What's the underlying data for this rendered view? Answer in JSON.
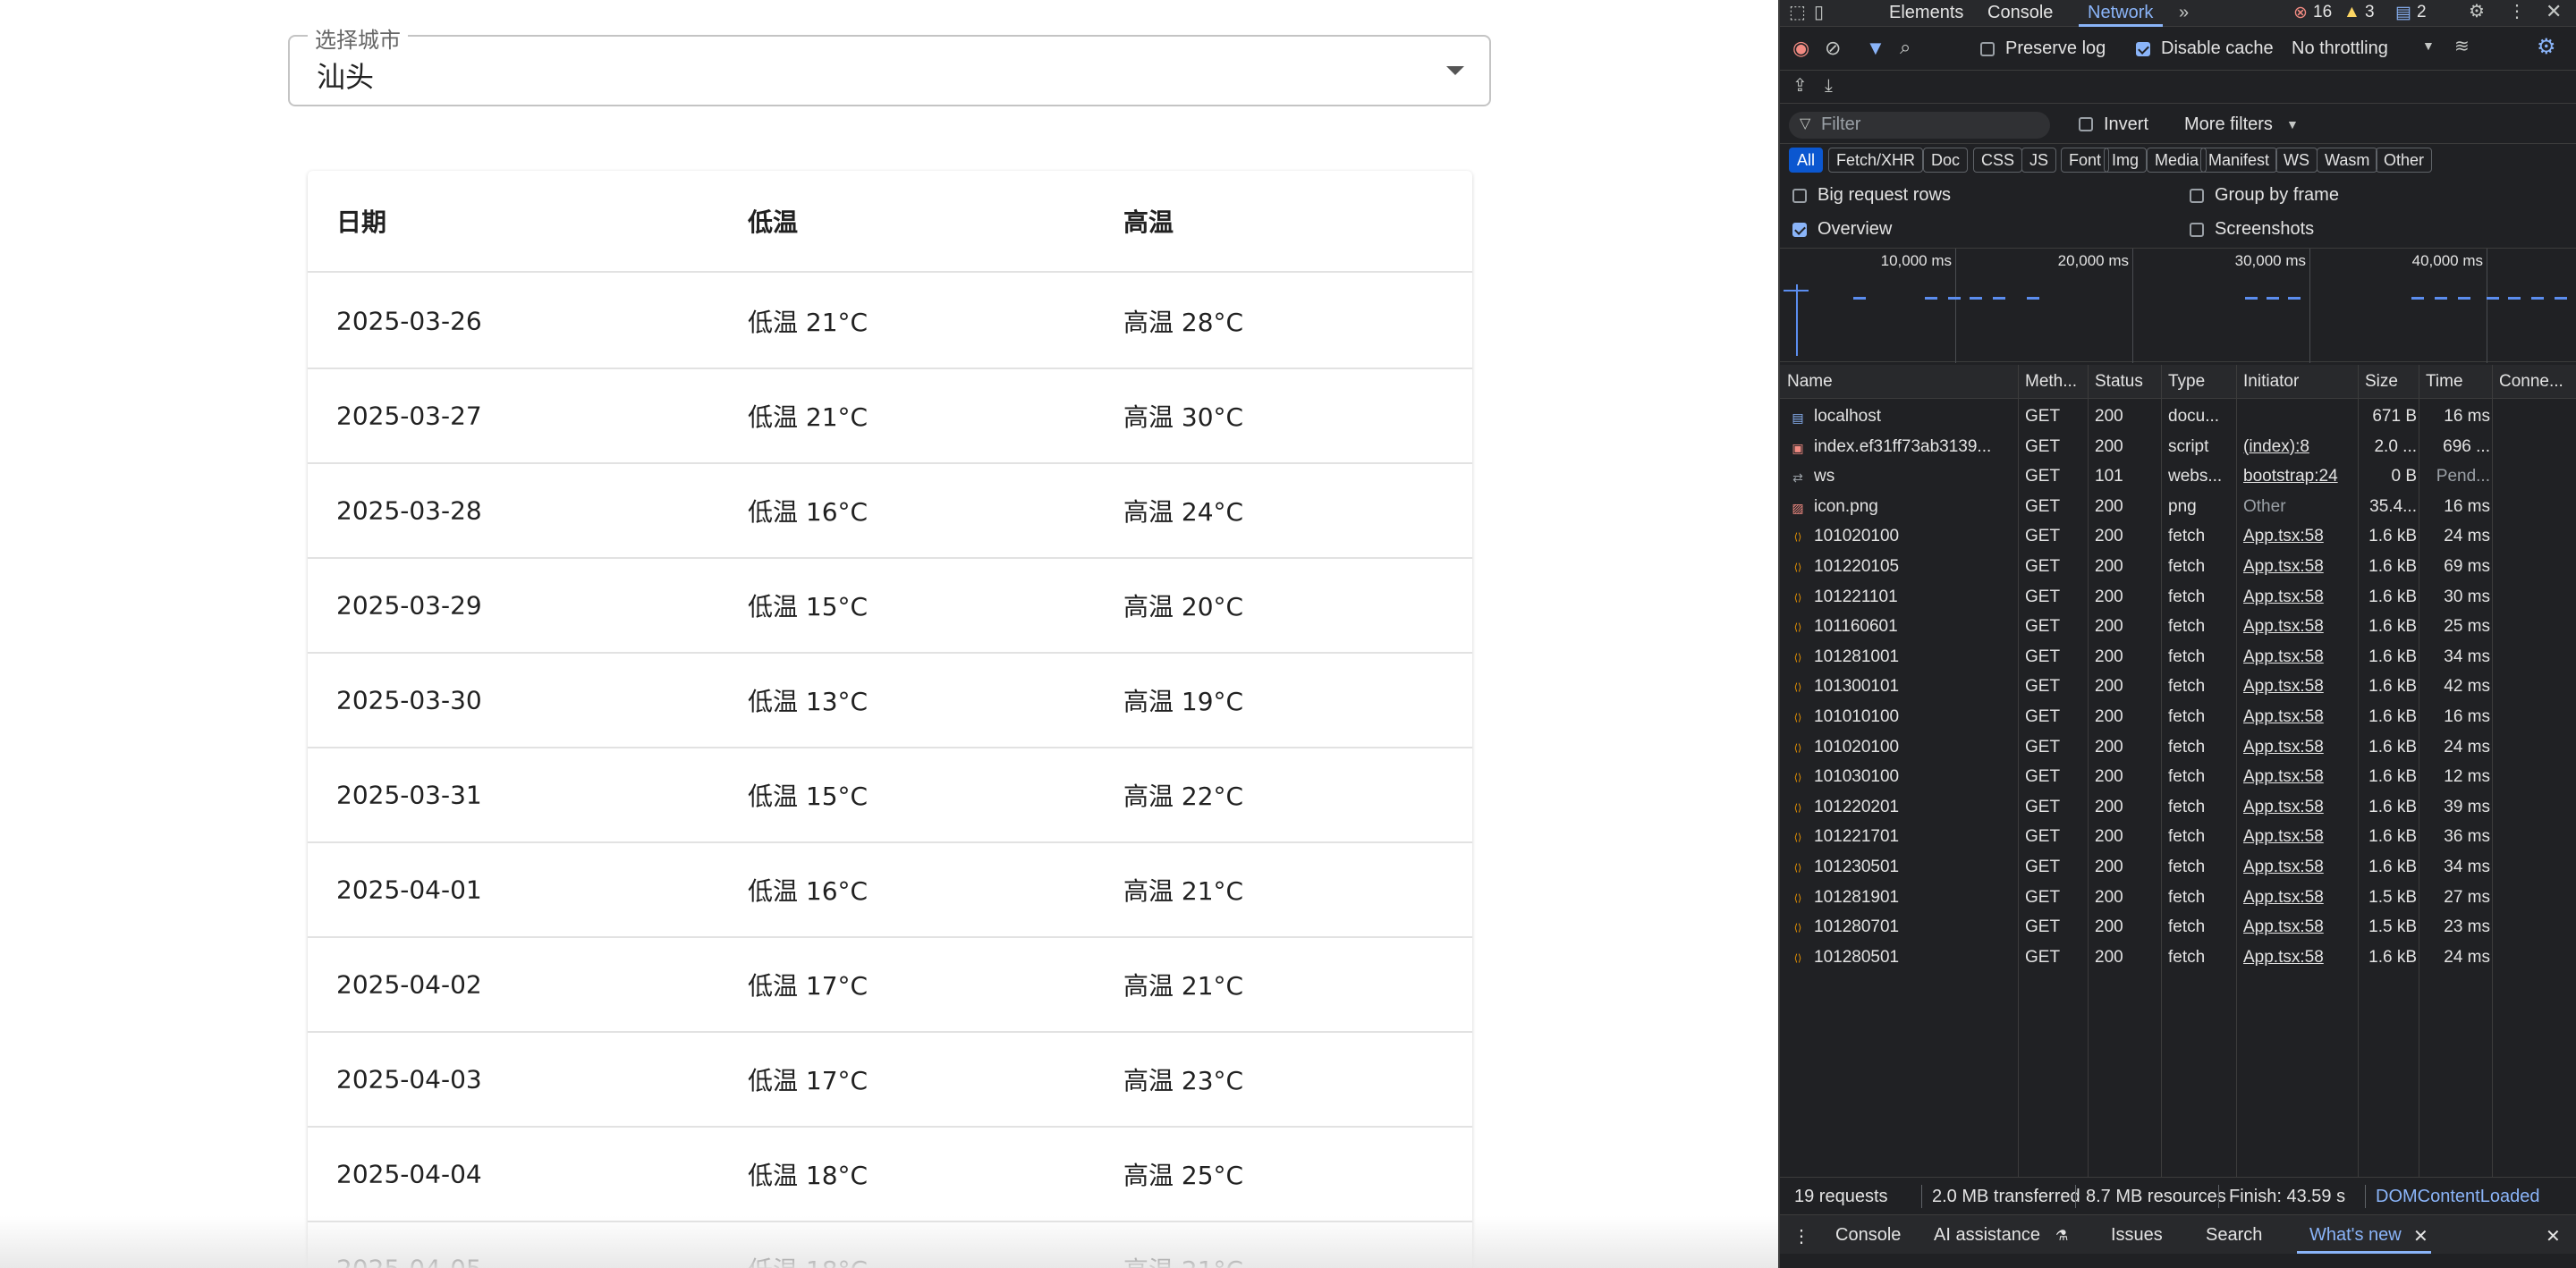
{
  "app": {
    "select": {
      "legend": "选择城市",
      "value": "汕头"
    },
    "table": {
      "headers": [
        "日期",
        "低温",
        "高温"
      ],
      "rows": [
        {
          "date": "2025-03-26",
          "low": "低温 21°C",
          "high": "高温 28°C"
        },
        {
          "date": "2025-03-27",
          "low": "低温 21°C",
          "high": "高温 30°C"
        },
        {
          "date": "2025-03-28",
          "low": "低温 16°C",
          "high": "高温 24°C"
        },
        {
          "date": "2025-03-29",
          "low": "低温 15°C",
          "high": "高温 20°C"
        },
        {
          "date": "2025-03-30",
          "low": "低温 13°C",
          "high": "高温 19°C"
        },
        {
          "date": "2025-03-31",
          "low": "低温 15°C",
          "high": "高温 22°C"
        },
        {
          "date": "2025-04-01",
          "low": "低温 16°C",
          "high": "高温 21°C"
        },
        {
          "date": "2025-04-02",
          "low": "低温 17°C",
          "high": "高温 21°C"
        },
        {
          "date": "2025-04-03",
          "low": "低温 17°C",
          "high": "高温 23°C"
        },
        {
          "date": "2025-04-04",
          "low": "低温 18°C",
          "high": "高温 25°C"
        },
        {
          "date": "2025-04-05",
          "low": "低温 18°C",
          "high": "高温 21°C"
        }
      ]
    }
  },
  "devtools": {
    "tabs": [
      "Elements",
      "Console",
      "Network"
    ],
    "active_tab": "Network",
    "badges": {
      "errors": "16",
      "warnings": "3",
      "messages": "2"
    },
    "toolbar": {
      "preserve_log": "Preserve log",
      "disable_cache": "Disable cache",
      "throttling": "No throttling"
    },
    "filter": {
      "placeholder": "Filter",
      "invert": "Invert",
      "more_filters": "More filters"
    },
    "chips": [
      "All",
      "Fetch/XHR",
      "Doc",
      "CSS",
      "JS",
      "Font",
      "Img",
      "Media",
      "Manifest",
      "WS",
      "Wasm",
      "Other"
    ],
    "options": {
      "big_request_rows": "Big request rows",
      "group_by_frame": "Group by frame",
      "overview": "Overview",
      "screenshots": "Screenshots"
    },
    "overview_ticks": [
      "10,000 ms",
      "20,000 ms",
      "30,000 ms",
      "40,000 ms"
    ],
    "columns": [
      "Name",
      "Meth...",
      "Status",
      "Type",
      "Initiator",
      "Size",
      "Time",
      "Conne..."
    ],
    "requests": [
      {
        "name": "localhost",
        "method": "GET",
        "status": "200",
        "type": "docu...",
        "initiator": "",
        "size": "671 B",
        "time": "16 ms",
        "icon": "document-icon"
      },
      {
        "name": "index.ef31ff73ab3139...",
        "method": "GET",
        "status": "200",
        "type": "script",
        "initiator": "(index):8",
        "size": "2.0 ...",
        "time": "696 ...",
        "icon": "script-icon"
      },
      {
        "name": "ws",
        "method": "GET",
        "status": "101",
        "type": "webs...",
        "initiator": "bootstrap:24",
        "size": "0 B",
        "time": "Pend...",
        "icon": "websocket-icon"
      },
      {
        "name": "icon.png",
        "method": "GET",
        "status": "200",
        "type": "png",
        "initiator": "Other",
        "size": "35.4...",
        "time": "16 ms",
        "icon": "image-icon"
      },
      {
        "name": "101020100",
        "method": "GET",
        "status": "200",
        "type": "fetch",
        "initiator": "App.tsx:58",
        "size": "1.6 kB",
        "time": "24 ms",
        "icon": "fetch-icon"
      },
      {
        "name": "101220105",
        "method": "GET",
        "status": "200",
        "type": "fetch",
        "initiator": "App.tsx:58",
        "size": "1.6 kB",
        "time": "69 ms",
        "icon": "fetch-icon"
      },
      {
        "name": "101221101",
        "method": "GET",
        "status": "200",
        "type": "fetch",
        "initiator": "App.tsx:58",
        "size": "1.6 kB",
        "time": "30 ms",
        "icon": "fetch-icon"
      },
      {
        "name": "101160601",
        "method": "GET",
        "status": "200",
        "type": "fetch",
        "initiator": "App.tsx:58",
        "size": "1.6 kB",
        "time": "25 ms",
        "icon": "fetch-icon"
      },
      {
        "name": "101281001",
        "method": "GET",
        "status": "200",
        "type": "fetch",
        "initiator": "App.tsx:58",
        "size": "1.6 kB",
        "time": "34 ms",
        "icon": "fetch-icon"
      },
      {
        "name": "101300101",
        "method": "GET",
        "status": "200",
        "type": "fetch",
        "initiator": "App.tsx:58",
        "size": "1.6 kB",
        "time": "42 ms",
        "icon": "fetch-icon"
      },
      {
        "name": "101010100",
        "method": "GET",
        "status": "200",
        "type": "fetch",
        "initiator": "App.tsx:58",
        "size": "1.6 kB",
        "time": "16 ms",
        "icon": "fetch-icon"
      },
      {
        "name": "101020100",
        "method": "GET",
        "status": "200",
        "type": "fetch",
        "initiator": "App.tsx:58",
        "size": "1.6 kB",
        "time": "24 ms",
        "icon": "fetch-icon"
      },
      {
        "name": "101030100",
        "method": "GET",
        "status": "200",
        "type": "fetch",
        "initiator": "App.tsx:58",
        "size": "1.6 kB",
        "time": "12 ms",
        "icon": "fetch-icon"
      },
      {
        "name": "101220201",
        "method": "GET",
        "status": "200",
        "type": "fetch",
        "initiator": "App.tsx:58",
        "size": "1.6 kB",
        "time": "39 ms",
        "icon": "fetch-icon"
      },
      {
        "name": "101221701",
        "method": "GET",
        "status": "200",
        "type": "fetch",
        "initiator": "App.tsx:58",
        "size": "1.6 kB",
        "time": "36 ms",
        "icon": "fetch-icon"
      },
      {
        "name": "101230501",
        "method": "GET",
        "status": "200",
        "type": "fetch",
        "initiator": "App.tsx:58",
        "size": "1.6 kB",
        "time": "34 ms",
        "icon": "fetch-icon"
      },
      {
        "name": "101281901",
        "method": "GET",
        "status": "200",
        "type": "fetch",
        "initiator": "App.tsx:58",
        "size": "1.5 kB",
        "time": "27 ms",
        "icon": "fetch-icon"
      },
      {
        "name": "101280701",
        "method": "GET",
        "status": "200",
        "type": "fetch",
        "initiator": "App.tsx:58",
        "size": "1.5 kB",
        "time": "23 ms",
        "icon": "fetch-icon"
      },
      {
        "name": "101280501",
        "method": "GET",
        "status": "200",
        "type": "fetch",
        "initiator": "App.tsx:58",
        "size": "1.6 kB",
        "time": "24 ms",
        "icon": "fetch-icon"
      }
    ],
    "status_bar": {
      "requests": "19 requests",
      "transferred": "2.0 MB transferred",
      "resources": "8.7 MB resources",
      "finish": "Finish: 43.59 s",
      "dom_loaded": "DOMContentLoaded"
    },
    "drawer_tabs": [
      "Console",
      "AI assistance",
      "Issues",
      "Search",
      "What's new"
    ],
    "drawer_active": "What's new",
    "colors": {
      "accent": "#8ab4f8",
      "error": "#f28b82",
      "warning": "#fdd663",
      "link_blue": "#0b57d0"
    }
  }
}
